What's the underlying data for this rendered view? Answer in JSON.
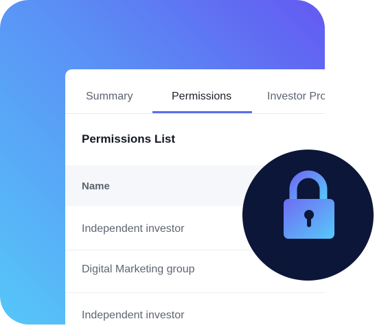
{
  "tabs": [
    {
      "label": "Summary"
    },
    {
      "label": "Permissions"
    },
    {
      "label": "Investor Pro"
    }
  ],
  "active_tab": "Permissions",
  "section": {
    "title": "Permissions List"
  },
  "table": {
    "columns": [
      {
        "label": "Name"
      }
    ],
    "rows": [
      {
        "name": "Independent investor"
      },
      {
        "name": "Digital Marketing group"
      },
      {
        "name": "Independent investor"
      }
    ]
  },
  "icons": {
    "lock": "lock-icon"
  },
  "colors": {
    "accent": "#5a6ef0",
    "badge": "#0b1638",
    "gradient_start": "#56c7f9",
    "gradient_end": "#6459f1"
  }
}
